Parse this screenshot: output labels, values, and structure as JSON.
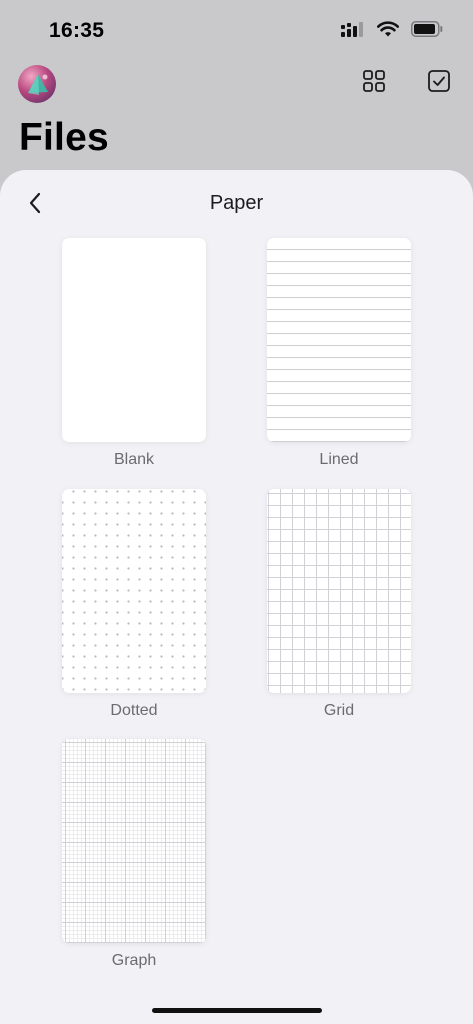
{
  "status_bar": {
    "time": "16:35",
    "icons": [
      "signal-icon",
      "wifi-icon",
      "battery-icon"
    ]
  },
  "header": {
    "title": "Files",
    "actions": [
      "grid-view-icon",
      "select-checkbox-icon"
    ]
  },
  "sheet": {
    "title": "Paper",
    "back_icon": "chevron-left-icon",
    "options": [
      {
        "label": "Blank",
        "pattern": "blank"
      },
      {
        "label": "Lined",
        "pattern": "lined"
      },
      {
        "label": "Dotted",
        "pattern": "dotted"
      },
      {
        "label": "Grid",
        "pattern": "grid"
      },
      {
        "label": "Graph",
        "pattern": "graph"
      }
    ]
  },
  "colors": {
    "background": "#c9c9cb",
    "sheet": "#f2f1f6",
    "label": "#6b6b70"
  }
}
